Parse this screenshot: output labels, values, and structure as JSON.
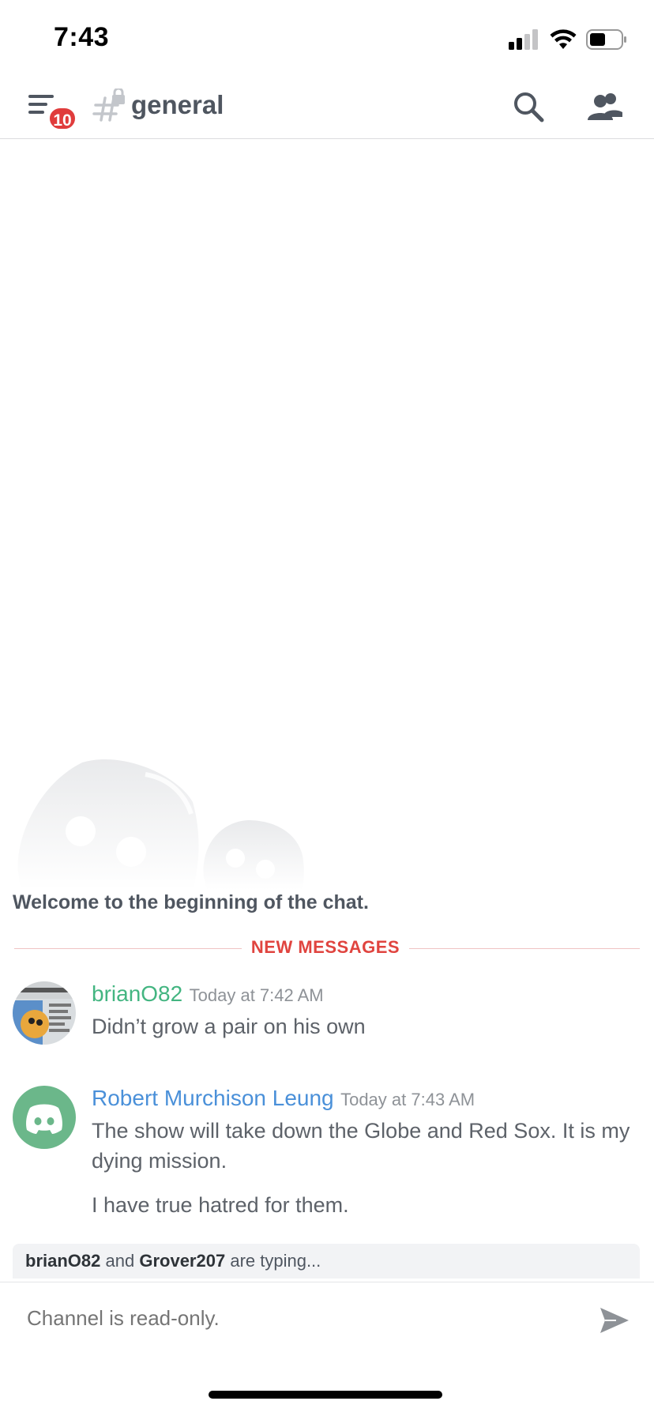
{
  "status_bar": {
    "time": "7:43",
    "icons": [
      "cellular-signal-icon",
      "wifi-icon",
      "battery-icon"
    ]
  },
  "header": {
    "menu_icon": "hamburger-menu-icon",
    "notification_badge": "10",
    "channel_icon": "locked-hashtag-icon",
    "channel_name": "general",
    "search_icon": "search-icon",
    "members_icon": "members-icon"
  },
  "chat": {
    "illustration": "discord-blob-illustration",
    "welcome_text": "Welcome to the beginning of the chat.",
    "new_messages_label": "NEW MESSAGES",
    "messages": [
      {
        "author": "brianO82",
        "author_color": "#43b581",
        "timestamp": "Today at 7:42 AM",
        "avatar": "comic-avatar",
        "lines": [
          "Didn’t grow a pair on his own"
        ]
      },
      {
        "author": "Robert Murchison Leung",
        "author_color": "#4a90d9",
        "timestamp": "Today at 7:43 AM",
        "avatar": "discord-logo-avatar",
        "avatar_color": "#6bb78a",
        "lines": [
          "The show will take down the Globe and Red Sox.  It is my dying mission.",
          "I have true hatred for them."
        ]
      }
    ]
  },
  "typing_indicator": {
    "user_1": "brianO82",
    "joiner": "and",
    "user_2": "Grover207",
    "suffix": "are typing..."
  },
  "composer": {
    "placeholder": "Channel is read-only.",
    "send_icon": "send-icon"
  },
  "colors": {
    "new_messages_red": "#e0443f",
    "badge_red": "#e03c3c"
  }
}
